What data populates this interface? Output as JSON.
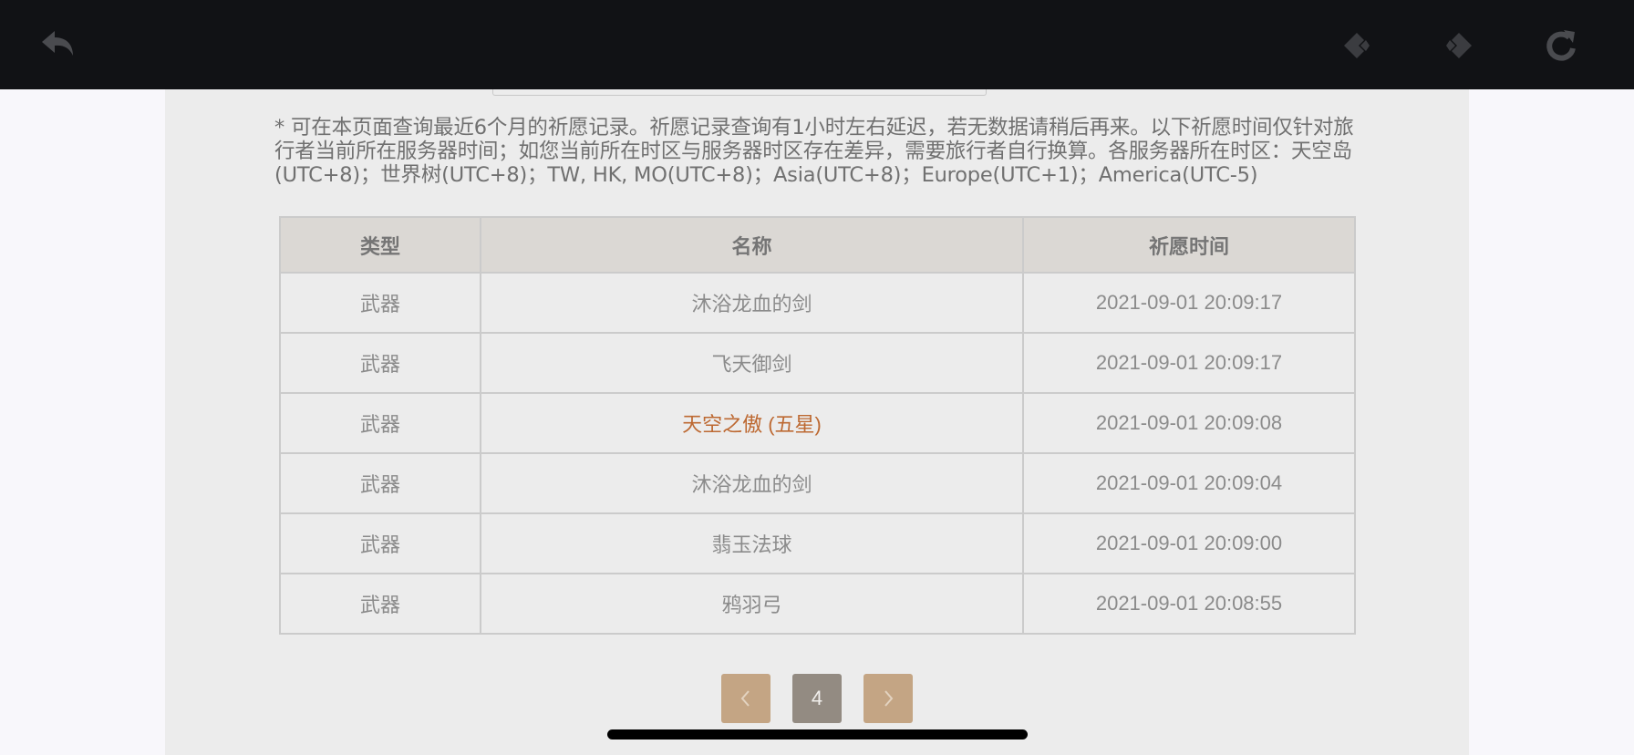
{
  "browser": {
    "icons": {
      "back": "back-arrow-icon",
      "prev": "diamond-arrow-left-icon",
      "next": "diamond-arrow-right-icon",
      "reload": "reload-icon"
    },
    "colors": {
      "bar": "#111215",
      "icon": "#4a4b4f"
    }
  },
  "notice": "* 可在本页面查询最近6个月的祈愿记录。祈愿记录查询有1小时左右延迟，若无数据请稍后再来。以下祈愿时间仅针对旅行者当前所在服务器时间；如您当前所在时区与服务器时区存在差异，需要旅行者自行换算。各服务器所在时区：天空岛(UTC+8)；世界树(UTC+8)；TW, HK, MO(UTC+8)；Asia(UTC+8)；Europe(UTC+1)；America(UTC-5)",
  "table": {
    "headers": [
      "类型",
      "名称",
      "祈愿时间"
    ],
    "rows": [
      {
        "type": "武器",
        "name": "沐浴龙血的剑",
        "time": "2021-09-01 20:09:17"
      },
      {
        "type": "武器",
        "name": "飞天御剑",
        "time": "2021-09-01 20:09:17"
      },
      {
        "type": "武器",
        "name": "天空之傲 (五星)",
        "time": "2021-09-01 20:09:08"
      },
      {
        "type": "武器",
        "name": "沐浴龙血的剑",
        "time": "2021-09-01 20:09:04"
      },
      {
        "type": "武器",
        "name": "翡玉法球",
        "time": "2021-09-01 20:09:00"
      },
      {
        "type": "武器",
        "name": "鸦羽弓",
        "time": "2021-09-01 20:08:55"
      }
    ]
  },
  "pagination": {
    "current_page": "4",
    "icons": {
      "prev": "chevron-left-icon",
      "next": "chevron-right-icon"
    }
  },
  "colors": {
    "five_star": "#bd6932",
    "page_nav": "#c4a584",
    "page_current": "#938b82",
    "header_bg": "#dbd8d4",
    "panel_bg": "#ececec"
  }
}
